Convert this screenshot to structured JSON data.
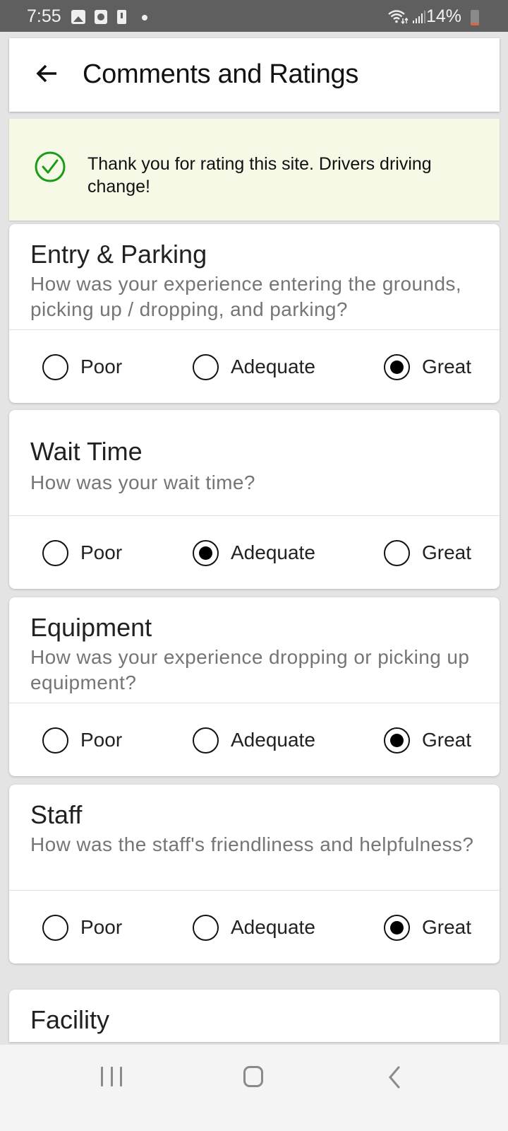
{
  "status_bar": {
    "time": "7:55",
    "notification_icons": [
      "image-icon",
      "clock-app-icon",
      "battery-alert-icon",
      "dot-icon"
    ],
    "wifi_icon": "wifi-icon",
    "signal_icon": "signal-icon",
    "battery_percent": "14%",
    "battery_level": 0.14
  },
  "app_bar": {
    "back_icon": "arrow-left-icon",
    "title": "Comments and Ratings"
  },
  "banner": {
    "icon": "check-circle-icon",
    "message": "Thank you for rating this site. Drivers driving change!",
    "accent_color": "#1a9c1a"
  },
  "rating_options": [
    "Poor",
    "Adequate",
    "Great"
  ],
  "categories": [
    {
      "title": "Entry & Parking",
      "description": "How was your experience entering the grounds, picking up / dropping, and parking?",
      "options": [
        "Poor",
        "Adequate",
        "Great"
      ],
      "selected": "Great"
    },
    {
      "title": "Wait Time",
      "description": "How was your wait time?",
      "options": [
        "Poor",
        "Adequate",
        "Great"
      ],
      "selected": "Adequate"
    },
    {
      "title": "Equipment",
      "description": "How was your experience dropping or picking up equipment?",
      "options": [
        "Poor",
        "Adequate",
        "Great"
      ],
      "selected": "Great"
    },
    {
      "title": "Staff",
      "description": "How was the staff's friendliness and helpfulness?",
      "options": [
        "Poor",
        "Adequate",
        "Great"
      ],
      "selected": "Great"
    },
    {
      "title": "Facility"
    }
  ],
  "nav_bar": {
    "recent_icon": "recent-apps-icon",
    "home_icon": "home-icon",
    "back_icon": "back-chevron-icon"
  }
}
